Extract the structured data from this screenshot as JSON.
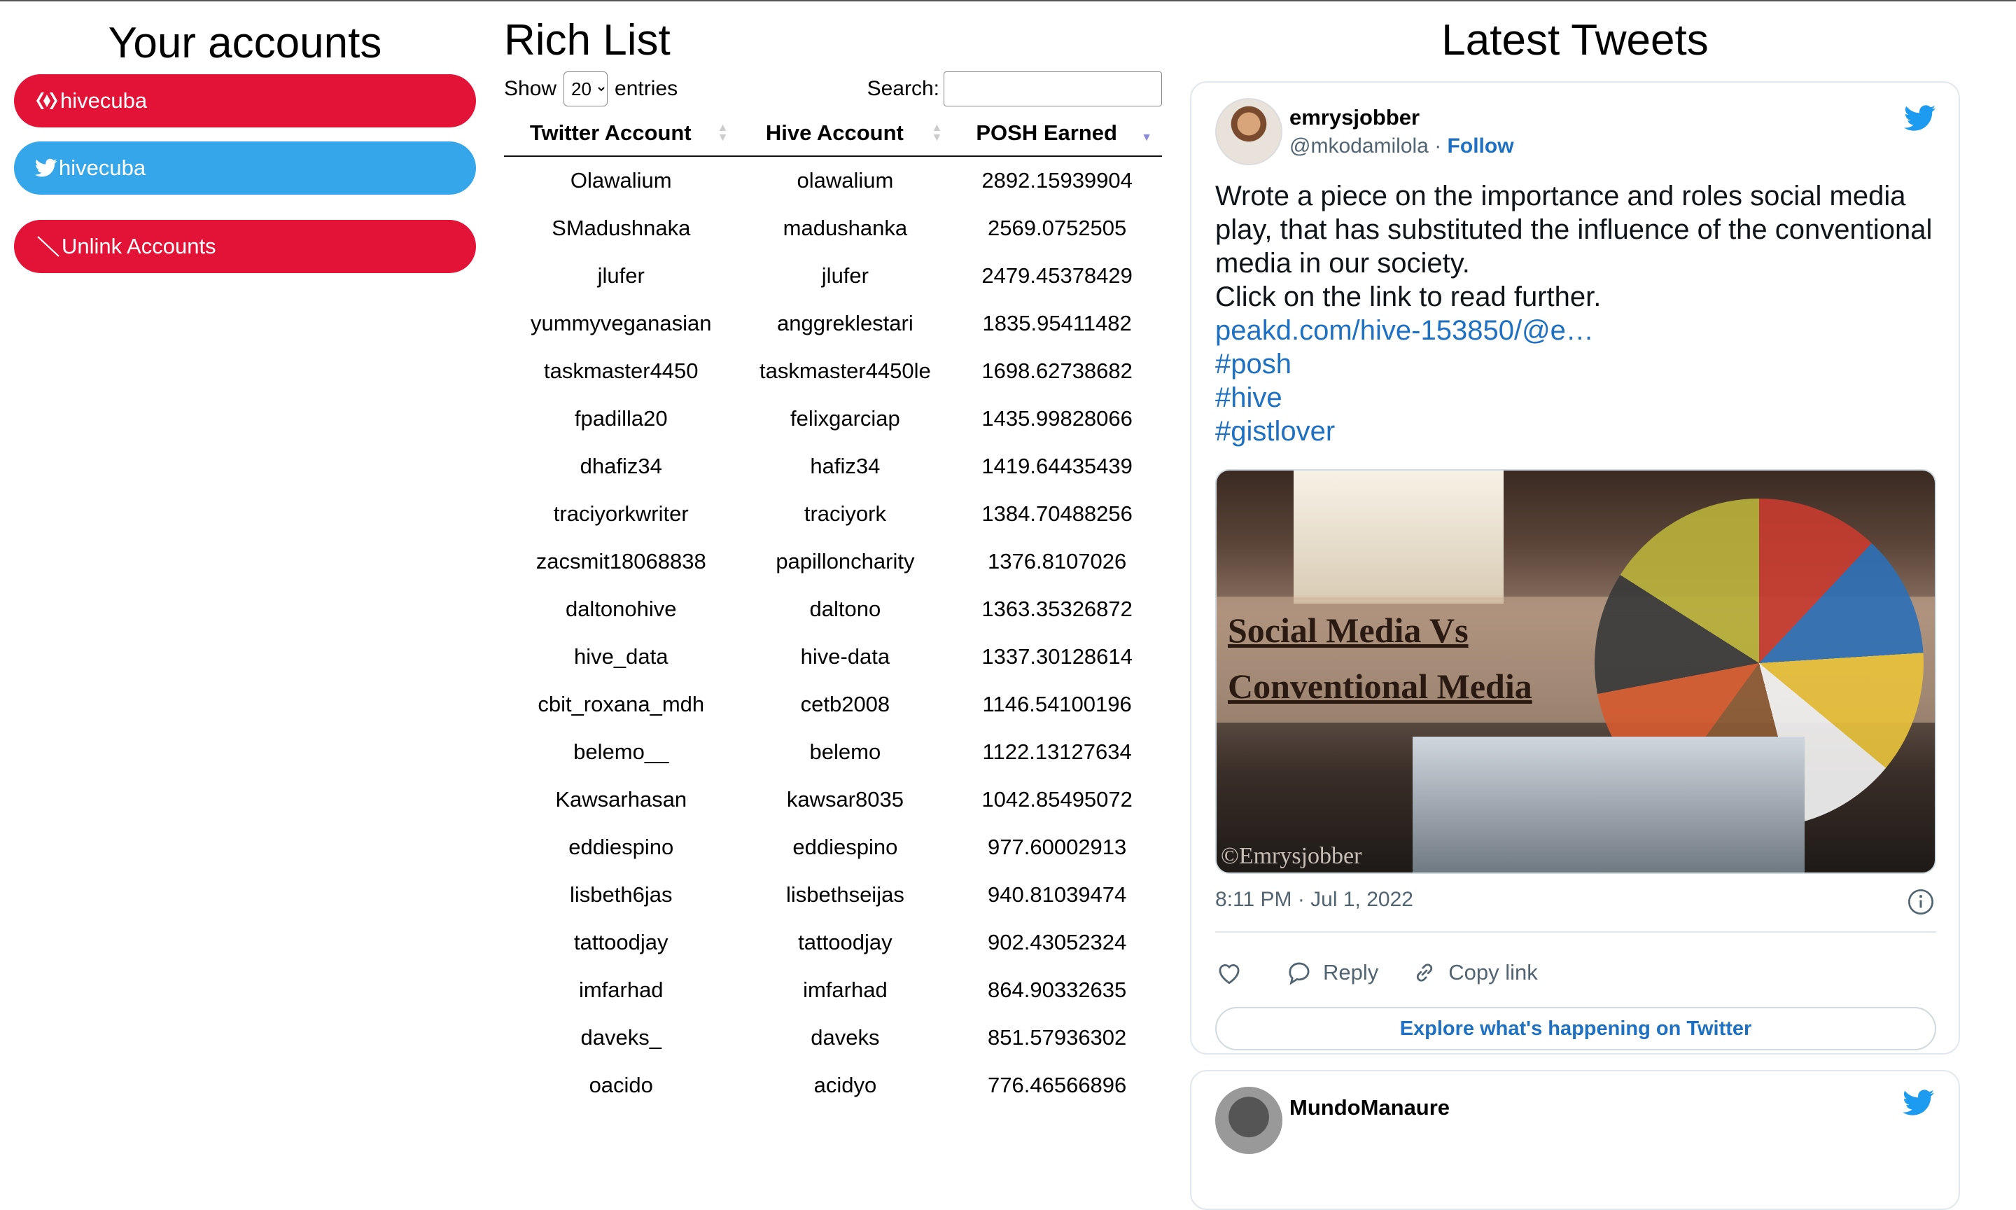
{
  "accounts": {
    "title": "Your accounts",
    "hive_label": "hivecuba",
    "twitter_label": "hivecuba",
    "unlink_label": "Unlink Accounts",
    "colors": {
      "hive": "#e31337",
      "twitter": "#35a6ea"
    }
  },
  "richlist": {
    "title": "Rich List",
    "show_label": "Show",
    "entries_value": "20",
    "entries_label": "entries",
    "search_label": "Search:",
    "search_value": "",
    "headers": [
      "Twitter Account",
      "Hive Account",
      "POSH Earned"
    ],
    "rows": [
      [
        "Olawalium",
        "olawalium",
        "2892.15939904"
      ],
      [
        "SMadushnaka",
        "madushanka",
        "2569.0752505"
      ],
      [
        "jlufer",
        "jlufer",
        "2479.45378429"
      ],
      [
        "yummyveganasian",
        "anggreklestari",
        "1835.95411482"
      ],
      [
        "taskmaster4450",
        "taskmaster4450le",
        "1698.62738682"
      ],
      [
        "fpadilla20",
        "felixgarciap",
        "1435.99828066"
      ],
      [
        "dhafiz34",
        "hafiz34",
        "1419.64435439"
      ],
      [
        "traciyorkwriter",
        "traciyork",
        "1384.70488256"
      ],
      [
        "zacsmit18068838",
        "papilloncharity",
        "1376.8107026"
      ],
      [
        "daltonohive",
        "daltono",
        "1363.35326872"
      ],
      [
        "hive_data",
        "hive-data",
        "1337.30128614"
      ],
      [
        "cbit_roxana_mdh",
        "cetb2008",
        "1146.54100196"
      ],
      [
        "belemo__",
        "belemo",
        "1122.13127634"
      ],
      [
        "Kawsarhasan",
        "kawsar8035",
        "1042.85495072"
      ],
      [
        "eddiespino",
        "eddiespino",
        "977.60002913"
      ],
      [
        "lisbeth6jas",
        "lisbethseijas",
        "940.81039474"
      ],
      [
        "tattoodjay",
        "tattoodjay",
        "902.43052324"
      ],
      [
        "imfarhad",
        "imfarhad",
        "864.90332635"
      ],
      [
        "daveks_",
        "daveks",
        "851.57936302"
      ],
      [
        "oacido",
        "acidyo",
        "776.46566896"
      ]
    ]
  },
  "tweets": {
    "title": "Latest Tweets",
    "tweet": {
      "name": "emrysjobber",
      "handle": "@mkodamilola",
      "separator": "·",
      "follow": "Follow",
      "text_line1": "Wrote a piece on the importance and roles social media play, that has substituted the influence of the conventional media in our society.",
      "text_line2": "Click on the link to read further.",
      "link": "peakd.com/hive-153850/@e…",
      "hashtags": [
        "#posh",
        "#hive",
        "#gistlover"
      ],
      "media_headline_1": "Social Media Vs",
      "media_headline_2": "Conventional Media",
      "media_credit": "©Emrysjobber",
      "timestamp": "8:11 PM · Jul 1, 2022",
      "reply_label": "Reply",
      "copy_label": "Copy link",
      "explore_label": "Explore what's happening on Twitter"
    },
    "tweet2": {
      "name": "MundoManaure"
    },
    "colors": {
      "link": "#1d70c2",
      "twitter_blue": "#1d9bf0"
    }
  }
}
